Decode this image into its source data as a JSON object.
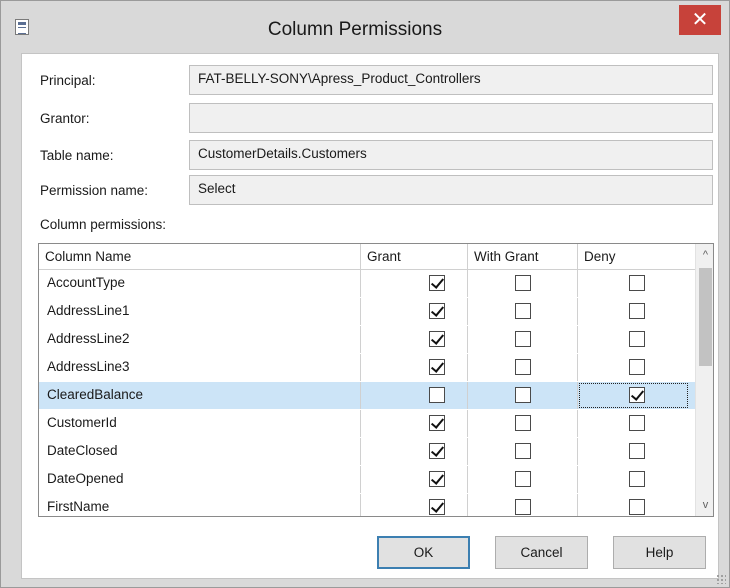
{
  "window": {
    "title": "Column Permissions",
    "close_glyph": "✕"
  },
  "fields": {
    "principal": {
      "label": "Principal:",
      "value": "FAT-BELLY-SONY\\Apress_Product_Controllers"
    },
    "grantor": {
      "label": "Grantor:",
      "value": ""
    },
    "table_name": {
      "label": "Table name:",
      "value": "CustomerDetails.Customers"
    },
    "permission_name": {
      "label": "Permission name:",
      "value": "Select"
    }
  },
  "column_permissions": {
    "label": "Column permissions:",
    "headers": [
      "Column Name",
      "Grant",
      "With Grant",
      "Deny"
    ],
    "rows": [
      {
        "name": "AccountType",
        "grant": true,
        "with_grant": false,
        "deny": false
      },
      {
        "name": "AddressLine1",
        "grant": true,
        "with_grant": false,
        "deny": false
      },
      {
        "name": "AddressLine2",
        "grant": true,
        "with_grant": false,
        "deny": false
      },
      {
        "name": "AddressLine3",
        "grant": true,
        "with_grant": false,
        "deny": false
      },
      {
        "name": "ClearedBalance",
        "grant": false,
        "with_grant": false,
        "deny": true,
        "selected": true
      },
      {
        "name": "CustomerId",
        "grant": true,
        "with_grant": false,
        "deny": false
      },
      {
        "name": "DateClosed",
        "grant": true,
        "with_grant": false,
        "deny": false
      },
      {
        "name": "DateOpened",
        "grant": true,
        "with_grant": false,
        "deny": false
      },
      {
        "name": "FirstName",
        "grant": true,
        "with_grant": false,
        "deny": false
      }
    ]
  },
  "scrollbar": {
    "up_glyph": "^",
    "down_glyph": "v"
  },
  "buttons": {
    "ok": "OK",
    "cancel": "Cancel",
    "help": "Help"
  },
  "colors": {
    "selected_row": "#cce4f7",
    "close_button": "#c7423a",
    "default_button_border": "#3c7fb1"
  }
}
